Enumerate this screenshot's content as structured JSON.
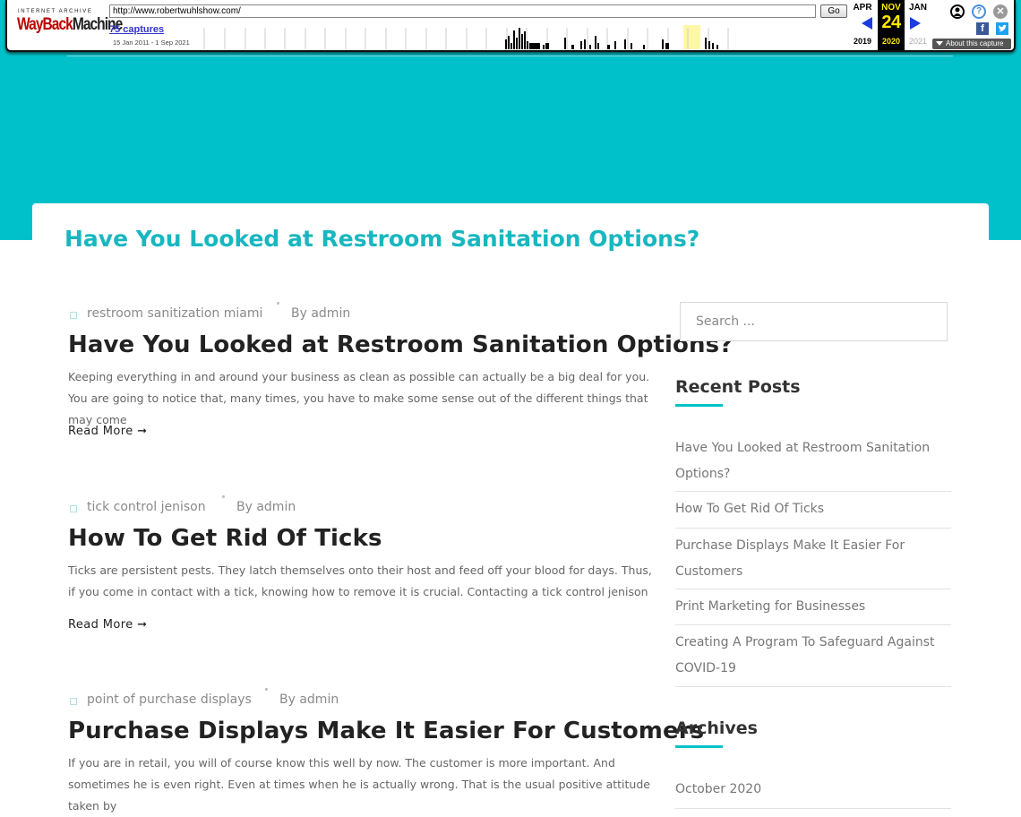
{
  "wayback": {
    "ia_label": "INTERNET ARCHIVE",
    "logo_wayback": "WayBack",
    "logo_machine": "Machine",
    "url": "http://www.robertwuhlshow.com/",
    "go_label": "Go",
    "captures": "75 captures",
    "range": "15 Jan 2011 - 1 Sep 2021",
    "prev_month": "APR",
    "prev_year": "2019",
    "cur_month": "NOV",
    "cur_day": "24",
    "cur_year": "2020",
    "next_month": "JAN",
    "next_year": "2021",
    "about": "About this capture",
    "icons": [
      "user-icon",
      "help-icon",
      "close-icon",
      "facebook-icon",
      "twitter-icon"
    ],
    "colors": {
      "arrow": "#1b3de0",
      "current": "#ffea00"
    }
  },
  "site": {
    "accent_color": "#00c1c9",
    "page_title": "Have You Looked at Restroom Sanitation Options?"
  },
  "posts": [
    {
      "category": "restroom sanitization miami",
      "author": "By admin",
      "title": "Have You Looked at Restroom Sanitation Options?",
      "excerpt": "Keeping everything in and around your business as clean as possible can actually be a big deal for you. You are going to notice that, many times, you have to make some sense out of the different things that may come",
      "read_more": "Read More"
    },
    {
      "category": "tick control jenison",
      "author": "By admin",
      "title": "How To Get Rid Of Ticks",
      "excerpt": "Ticks are persistent pests. They latch themselves onto their host and feed off your blood for days. Thus, if you come in contact with a tick, knowing how to remove it is crucial. Contacting a tick control jenison",
      "read_more": "Read More"
    },
    {
      "category": "point of purchase displays",
      "author": "By admin",
      "title": "Purchase Displays Make It Easier For Customers",
      "excerpt": "If you are in retail, you will of course know this well by now. The customer is more important. And sometimes he is even right. Even at times when he is actually wrong. That is the usual positive attitude taken by"
    }
  ],
  "sidebar": {
    "search_placeholder": "Search ...",
    "recent_title": "Recent Posts",
    "recent_posts": [
      "Have You Looked at Restroom Sanitation Options?",
      "How To Get Rid Of Ticks",
      "Purchase Displays Make It Easier For Customers",
      "Print Marketing for Businesses",
      "Creating A Program To Safeguard Against COVID-19"
    ],
    "archives_title": "Archives",
    "archives": [
      "October 2020"
    ]
  }
}
